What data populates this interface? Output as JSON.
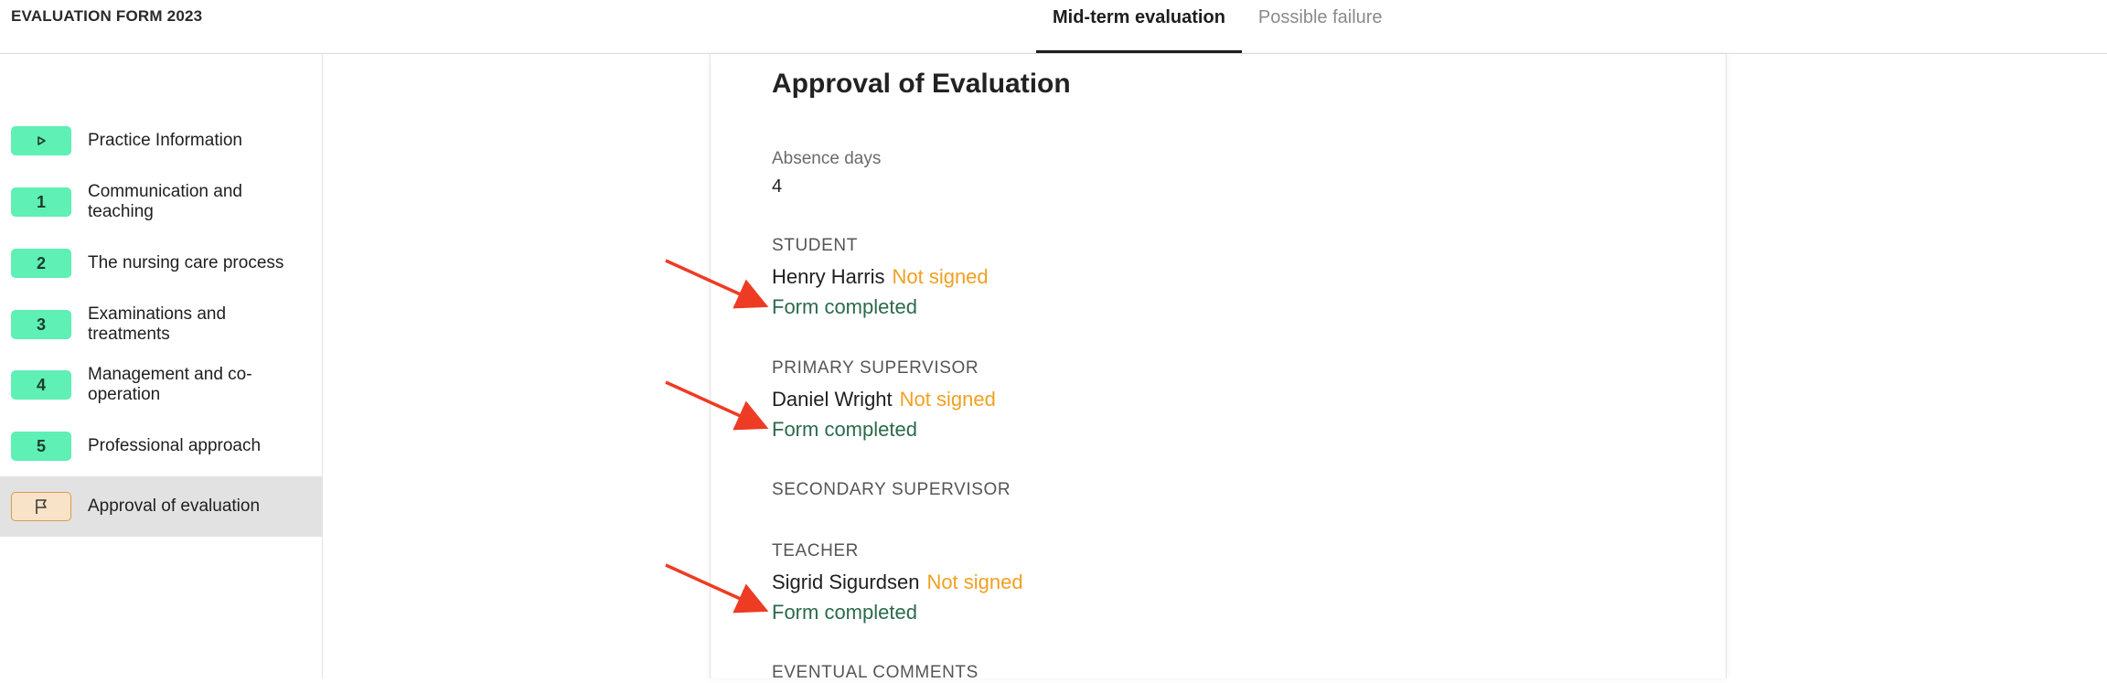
{
  "app": {
    "title": "EVALUATION FORM 2023"
  },
  "tabs": [
    {
      "label": "Mid-term evaluation",
      "active": true
    },
    {
      "label": "Possible failure",
      "active": false
    }
  ],
  "sidebar": {
    "items": [
      {
        "badge": "",
        "icon": "play-icon",
        "label": "Practice Information"
      },
      {
        "badge": "1",
        "label": "Communication and teaching"
      },
      {
        "badge": "2",
        "label": "The nursing care process"
      },
      {
        "badge": "3",
        "label": "Examinations and treatments"
      },
      {
        "badge": "4",
        "label": "Management and co-operation"
      },
      {
        "badge": "5",
        "label": "Professional approach"
      },
      {
        "badge": "",
        "icon": "flag-icon",
        "label": "Approval of evaluation",
        "selected": true
      }
    ]
  },
  "main": {
    "title": "Approval of Evaluation",
    "absence": {
      "label": "Absence days",
      "value": "4"
    },
    "student": {
      "section": "STUDENT",
      "name": "Henry Harris",
      "status": "Not signed",
      "form_status": "Form completed"
    },
    "primary_supervisor": {
      "section": "PRIMARY SUPERVISOR",
      "name": "Daniel Wright",
      "status": "Not signed",
      "form_status": "Form completed"
    },
    "secondary_supervisor": {
      "section": "SECONDARY SUPERVISOR"
    },
    "teacher": {
      "section": "TEACHER",
      "name": "Sigrid Sigurdsen",
      "status": "Not signed",
      "form_status": "Form completed"
    },
    "comments": {
      "section": "EVENTUAL COMMENTS"
    }
  },
  "colors": {
    "badge_green": "#5ef0b4",
    "not_signed": "#f0a020",
    "form_completed": "#2b6a4c",
    "annotation_arrow": "#ee3b24"
  }
}
